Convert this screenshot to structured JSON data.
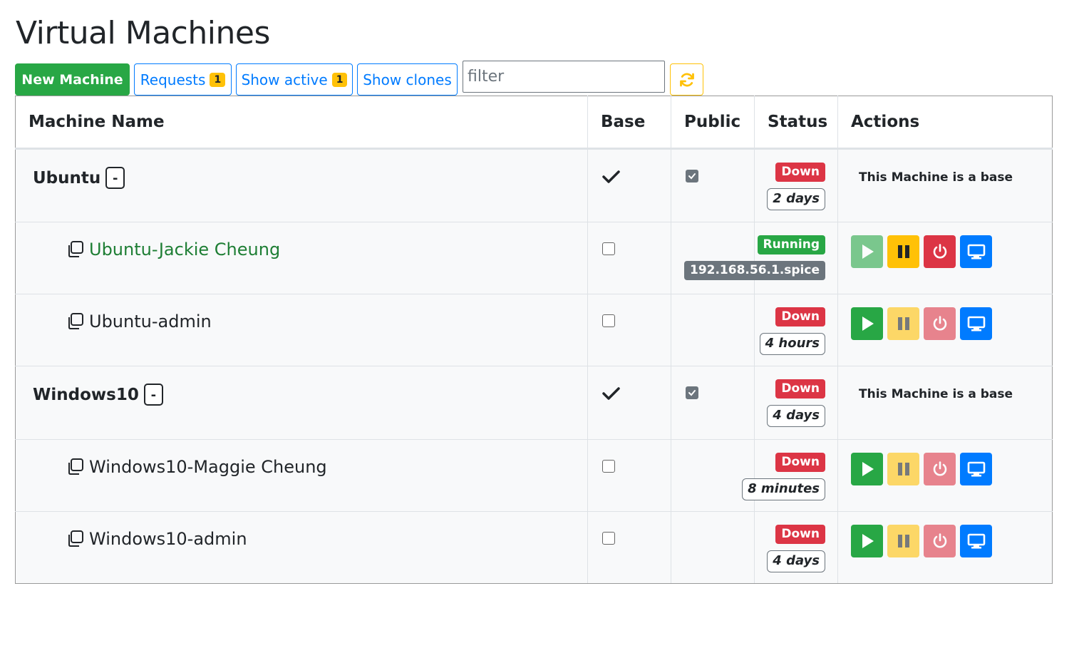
{
  "page": {
    "title": "Virtual Machines"
  },
  "toolbar": {
    "new_machine_label": "New Machine",
    "requests_label": "Requests",
    "requests_count": "1",
    "show_active_label": "Show active",
    "show_active_count": "1",
    "show_clones_label": "Show clones",
    "filter_placeholder": "filter",
    "refresh_icon": "refresh-icon"
  },
  "table": {
    "headers": {
      "name": "Machine Name",
      "base": "Base",
      "public": "Public",
      "status": "Status",
      "actions": "Actions"
    },
    "base_message": "This Machine is a base",
    "collapse_label": "-",
    "rows": [
      {
        "name": "Ubuntu",
        "type": "base",
        "is_base": true,
        "public": true,
        "status": "Down",
        "time": "2 days"
      },
      {
        "name": "Ubuntu-Jackie Cheung",
        "type": "clone",
        "is_base": false,
        "status": "Running",
        "ip": "192.168.56.1.spice",
        "running": true
      },
      {
        "name": "Ubuntu-admin",
        "type": "clone",
        "is_base": false,
        "status": "Down",
        "time": "4 hours"
      },
      {
        "name": "Windows10",
        "type": "base",
        "is_base": true,
        "public": true,
        "status": "Down",
        "time": "4 days"
      },
      {
        "name": "Windows10-Maggie Cheung",
        "type": "clone",
        "is_base": false,
        "status": "Down",
        "time": "8 minutes"
      },
      {
        "name": "Windows10-admin",
        "type": "clone",
        "is_base": false,
        "status": "Down",
        "time": "4 days"
      }
    ]
  },
  "colors": {
    "success": "#28a745",
    "warning": "#ffc107",
    "danger": "#dc3545",
    "primary": "#007bff",
    "secondary": "#6c757d"
  }
}
